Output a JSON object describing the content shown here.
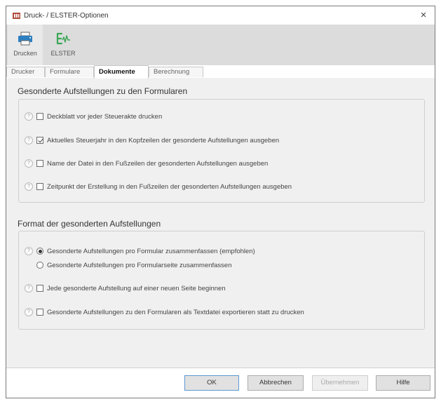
{
  "window": {
    "title": "Druck- / ELSTER-Optionen",
    "close_label": "×"
  },
  "ribbon": {
    "items": [
      {
        "label": "Drucken",
        "icon": "printer-icon"
      },
      {
        "label": "ELSTER",
        "icon": "elster-icon"
      }
    ]
  },
  "tabs": [
    {
      "label": "Drucker",
      "active": false
    },
    {
      "label": "Formulare",
      "active": false
    },
    {
      "label": "Dokumente",
      "active": true
    },
    {
      "label": "Berechnung",
      "active": false
    }
  ],
  "section1": {
    "title": "Gesonderte Aufstellungen zu den Formularen",
    "options": [
      {
        "label": "Deckblatt vor jeder Steuerakte drucken",
        "checked": false
      },
      {
        "label": "Aktuelles Steuerjahr in den Kopfzeilen der gesonderte Aufstellungen ausgeben",
        "checked": true
      },
      {
        "label": "Name der Datei in den Fußzeilen der gesonderten Aufstellungen ausgeben",
        "checked": false
      },
      {
        "label": "Zeitpunkt der Erstellung in den Fußzeilen der gesonderten Aufstellungen ausgeben",
        "checked": false
      }
    ]
  },
  "section2": {
    "title": "Format der gesonderten Aufstellungen",
    "radios": [
      {
        "label": "Gesonderte Aufstellungen pro Formular zusammenfassen (empfohlen)",
        "checked": true
      },
      {
        "label": "Gesonderte Aufstellungen pro Formularseite zusammenfassen",
        "checked": false
      }
    ],
    "checkboxes": [
      {
        "label": "Jede gesonderte Aufstellung auf einer neuen Seite beginnen",
        "checked": false
      },
      {
        "label": "Gesonderte Aufstellungen zu den Formularen als Textdatei exportieren statt zu drucken",
        "checked": false
      }
    ]
  },
  "help_glyph": "?",
  "footer": {
    "ok": "OK",
    "cancel": "Abbrechen",
    "apply": "Übernehmen",
    "help": "Hilfe"
  },
  "colors": {
    "ribbon_bg": "#dcdcdc",
    "content_bg": "#f0f0f0",
    "ok_border": "#5d99d1",
    "printer_blue": "#2d7fc1",
    "elster_green": "#3aa655"
  }
}
